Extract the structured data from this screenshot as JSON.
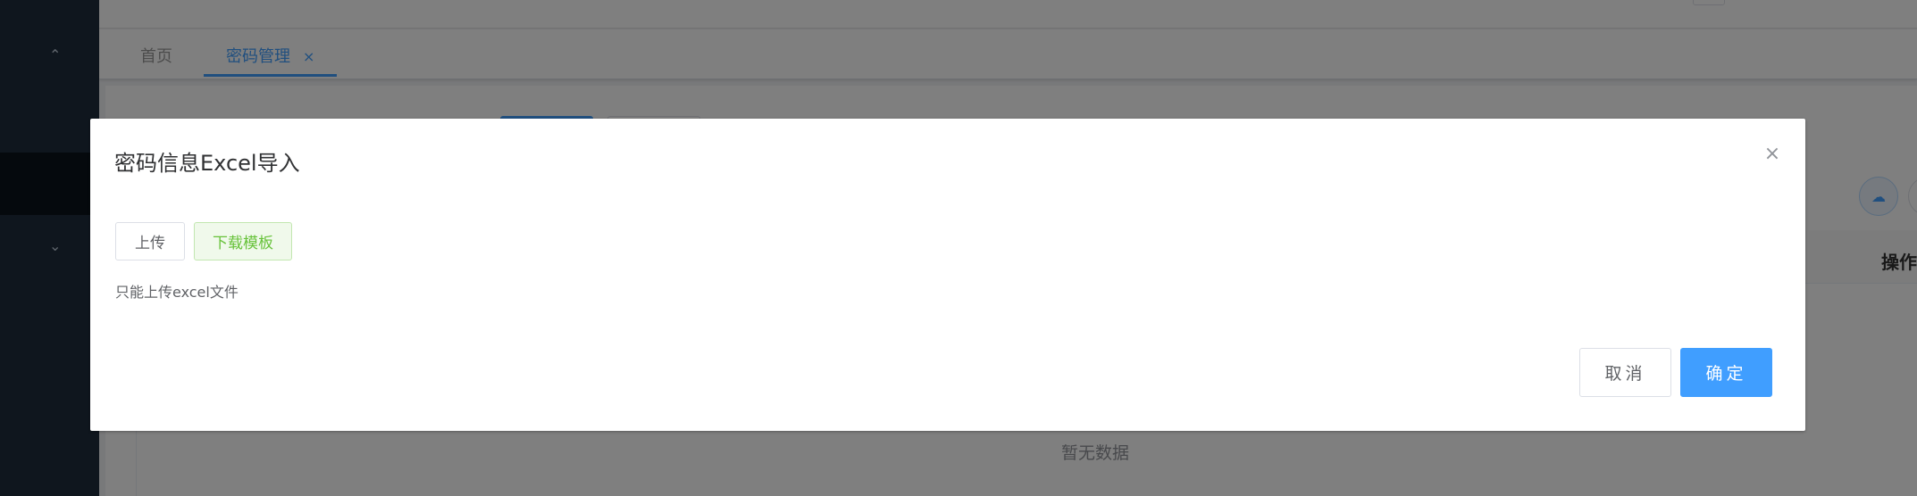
{
  "sidebar": {
    "up_chevron": "⌃",
    "down_chevron": "⌄"
  },
  "tags": {
    "home": "首页",
    "active": "密码管理",
    "close": "×"
  },
  "content": {
    "upload_icon": "☁",
    "op_header": "操作",
    "empty_text": "暂无数据"
  },
  "dialog": {
    "title": "密码信息Excel导入",
    "close": "×",
    "upload_label": "上传",
    "template_label": "下载模板",
    "tip": "只能上传excel文件",
    "cancel_label": "取消",
    "ok_label": "确定"
  },
  "colors": {
    "primary": "#409eff",
    "success": "#67c23a",
    "sidebar": "#1f2d3d"
  }
}
